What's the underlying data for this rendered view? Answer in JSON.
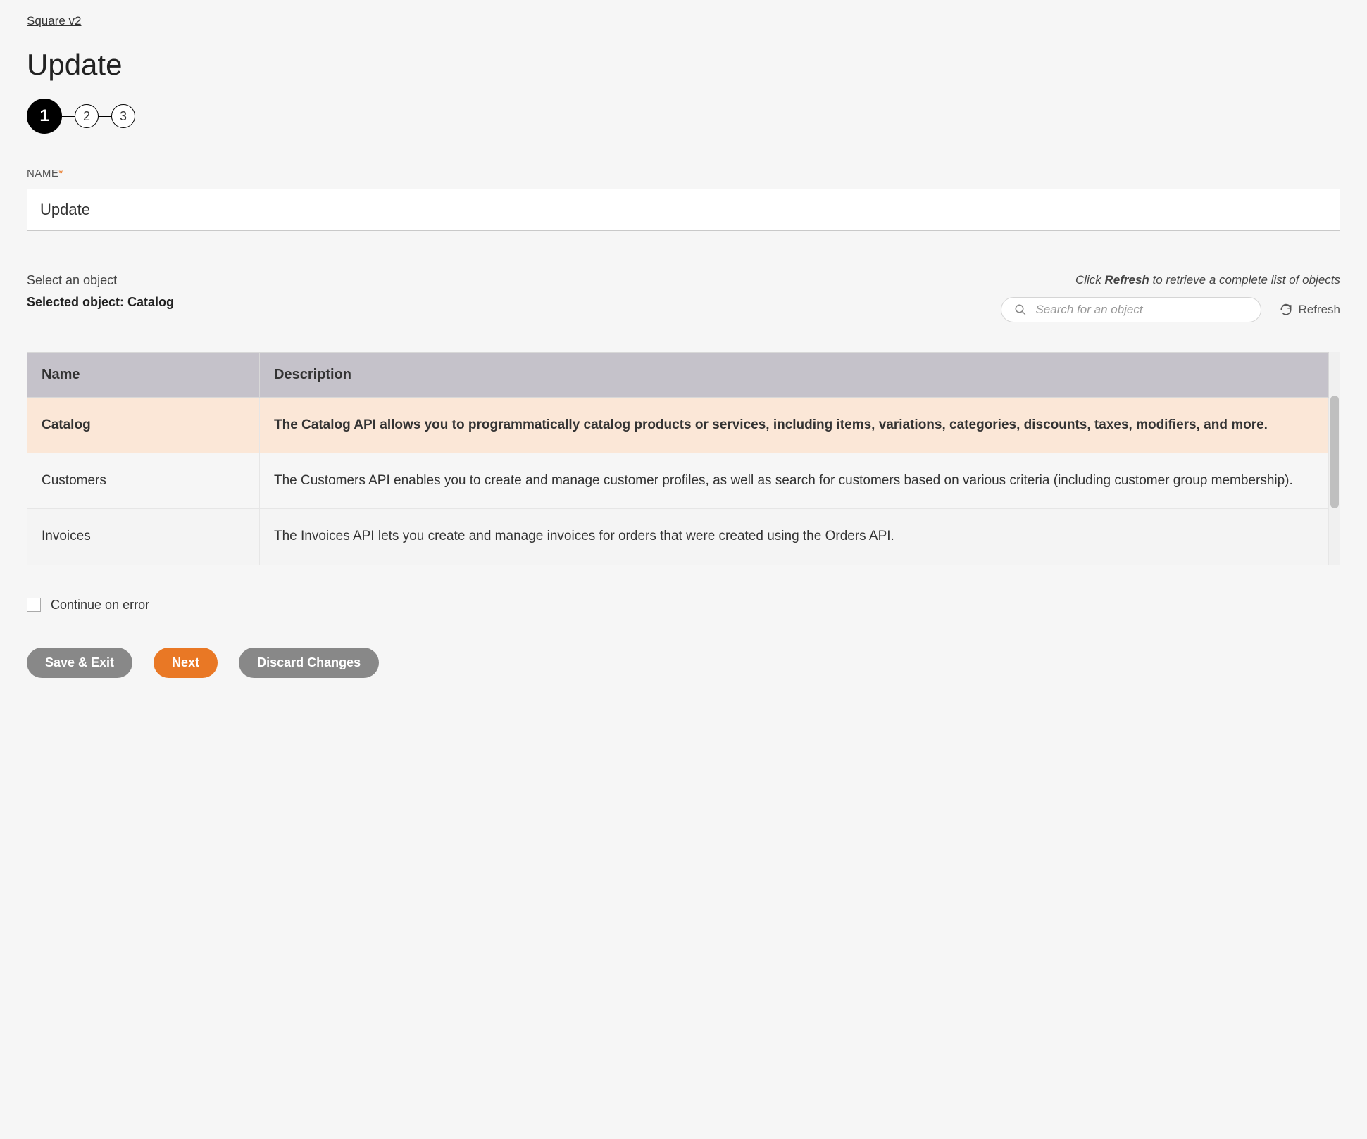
{
  "breadcrumb": "Square v2",
  "page_title": "Update",
  "stepper": {
    "current": 1,
    "steps": [
      "1",
      "2",
      "3"
    ]
  },
  "name_field": {
    "label": "NAME",
    "value": "Update"
  },
  "object_select": {
    "hint": "Select an object",
    "selected_prefix": "Selected object: ",
    "selected_value": "Catalog",
    "refresh_hint_pre": "Click ",
    "refresh_hint_bold": "Refresh",
    "refresh_hint_post": " to retrieve a complete list of objects",
    "search_placeholder": "Search for an object",
    "refresh_label": "Refresh"
  },
  "table": {
    "columns": {
      "name": "Name",
      "description": "Description"
    },
    "rows": [
      {
        "name": "Catalog",
        "description": "The Catalog API allows you to programmatically catalog products or services, including items, variations, categories, discounts, taxes, modifiers, and more.",
        "selected": true
      },
      {
        "name": "Customers",
        "description": "The Customers API enables you to create and manage customer profiles, as well as search for customers based on various criteria (including customer group membership).",
        "selected": false
      },
      {
        "name": "Invoices",
        "description": "The Invoices API lets you create and manage invoices for orders that were created using the Orders API.",
        "selected": false
      }
    ]
  },
  "continue_on_error": {
    "label": "Continue on error",
    "checked": false
  },
  "buttons": {
    "save_exit": "Save & Exit",
    "next": "Next",
    "discard": "Discard Changes"
  }
}
